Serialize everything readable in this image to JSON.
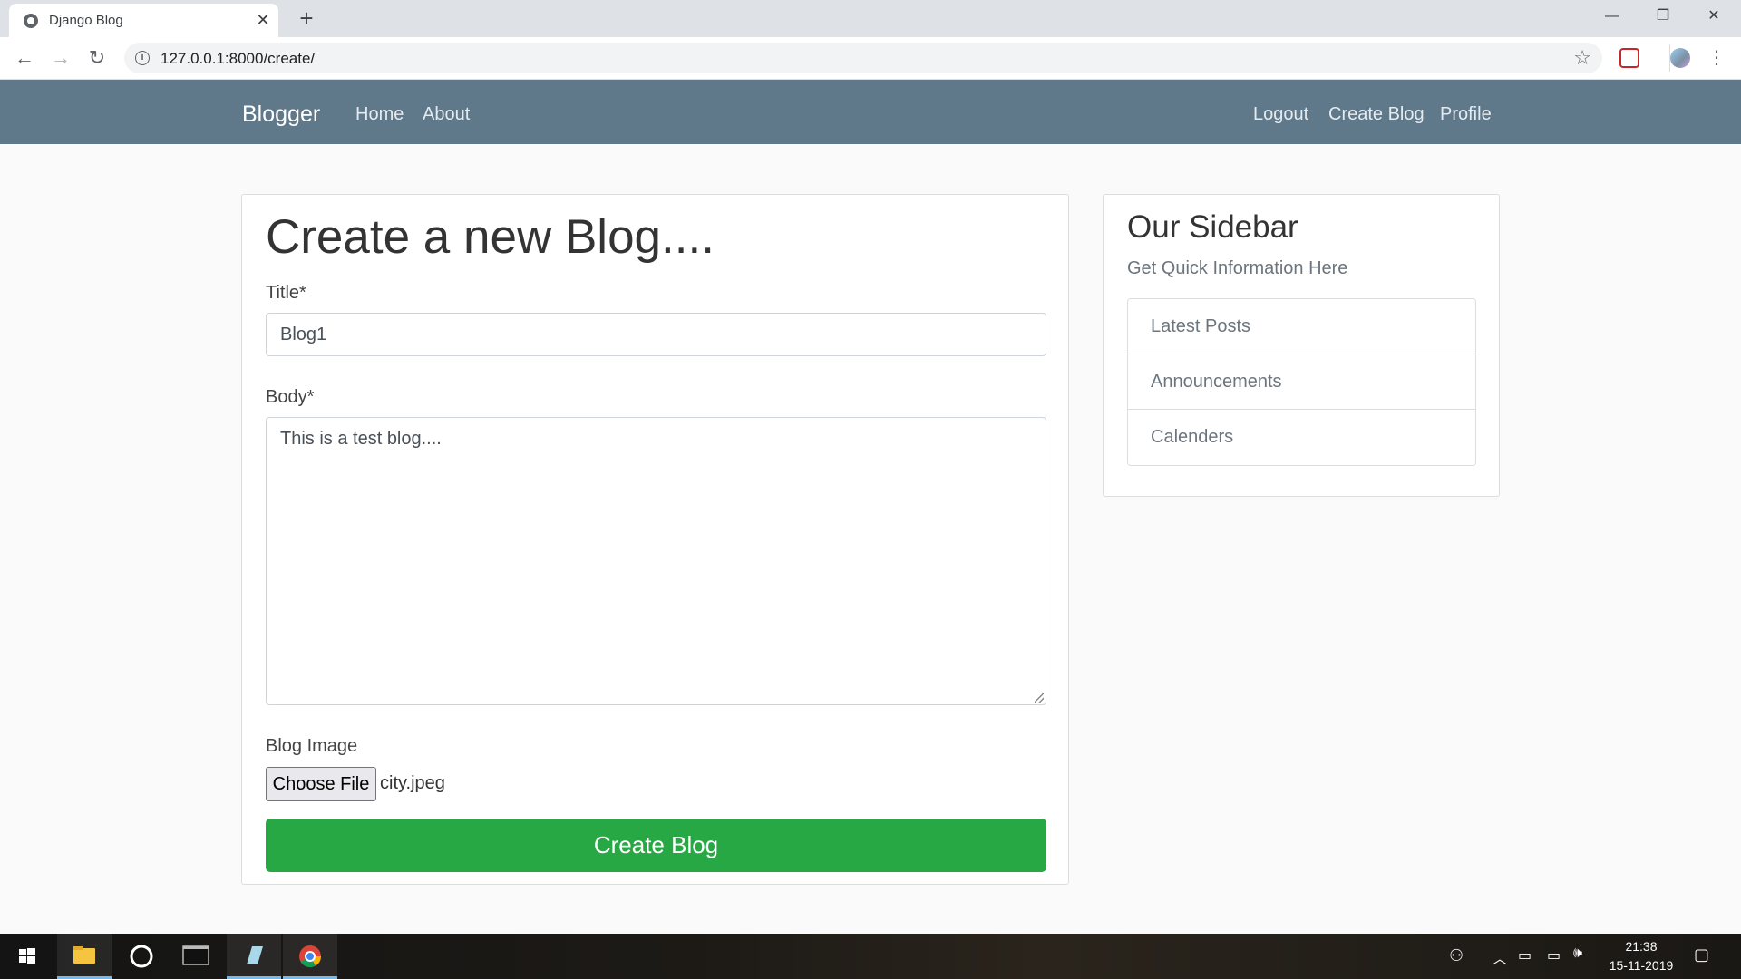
{
  "browser": {
    "tab_title": "Django Blog",
    "tab_close": "✕",
    "new_tab": "+",
    "url": "127.0.0.1:8000/create/",
    "window_minimize": "—",
    "window_restore": "❐",
    "window_close": "✕"
  },
  "navbar": {
    "brand": "Blogger",
    "left_links": [
      "Home",
      "About"
    ],
    "right_links": [
      "Logout",
      "Create Blog",
      "Profile"
    ]
  },
  "form": {
    "heading": "Create a new Blog....",
    "title_label": "Title*",
    "title_value": "Blog1",
    "body_label": "Body*",
    "body_value": "This is a test blog....",
    "image_label": "Blog Image",
    "choose_file_label": "Choose File",
    "file_name": "city.jpeg",
    "submit_label": "Create Blog"
  },
  "sidebar": {
    "title": "Our Sidebar",
    "subtitle": "Get Quick Information Here",
    "items": [
      "Latest Posts",
      "Announcements",
      "Calenders"
    ]
  },
  "taskbar": {
    "time": "21:38",
    "date": "15-11-2019"
  },
  "colors": {
    "navbar": "#5f788a",
    "submit_button": "#28a745",
    "taskbar": "#1a1815"
  }
}
